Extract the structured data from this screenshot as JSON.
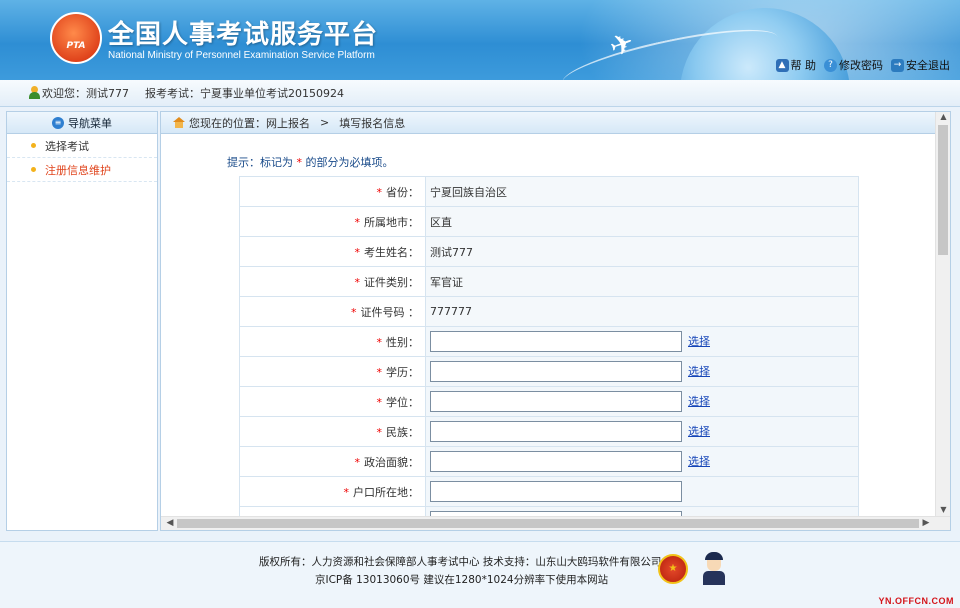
{
  "header": {
    "title_cn": "全国人事考试服务平台",
    "title_en": "National Ministry of Personnel Examination Service Platform",
    "logo_text": "PTA",
    "links": {
      "help": "帮 助",
      "change_password": "修改密码",
      "logout": "安全退出"
    }
  },
  "welcome": {
    "greeting": "欢迎您：测试777",
    "exam": "报考考试：宁夏事业单位考试20150924"
  },
  "sidebar": {
    "title": "导航菜单",
    "items": [
      {
        "label": "选择考试"
      },
      {
        "label": "注册信息维护"
      }
    ]
  },
  "breadcrumb": {
    "prefix": "您现在的位置：网上报名",
    "separator": ">",
    "current": "填写报名信息"
  },
  "form": {
    "tip_before": "提示：标记为 ",
    "tip_star": "*",
    "tip_after": " 的部分为必填项。",
    "required_mark": "*",
    "select_label": "选择",
    "rows": [
      {
        "label": "省份：",
        "value": "宁夏回族自治区"
      },
      {
        "label": "所属地市：",
        "value": "区直"
      },
      {
        "label": "考生姓名：",
        "value": "测试777"
      },
      {
        "label": "证件类别：",
        "value": "军官证"
      },
      {
        "label": "证件号码 ：",
        "value": "777777"
      },
      {
        "label": "性别：",
        "value": ""
      },
      {
        "label": "学历：",
        "value": ""
      },
      {
        "label": "学位：",
        "value": ""
      },
      {
        "label": "民族：",
        "value": ""
      },
      {
        "label": "政治面貌：",
        "value": ""
      },
      {
        "label": "户口所在地：",
        "value": ""
      }
    ]
  },
  "footer": {
    "line1": "版权所有：人力资源和社会保障部人事考试中心  技术支持：山东山大鸥玛软件有限公司",
    "line2": "京ICP备 13013060号  建议在1280*1024分辨率下使用本网站"
  },
  "watermark": "YN.OFFCN.COM"
}
